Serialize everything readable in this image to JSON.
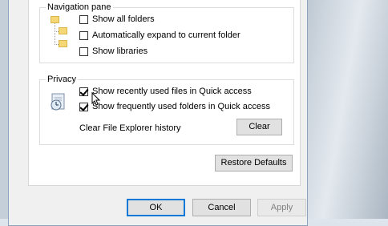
{
  "navigation_pane": {
    "title": "Navigation pane",
    "options": [
      {
        "label": "Show all folders",
        "checked": false
      },
      {
        "label": "Automatically expand to current folder",
        "checked": false
      },
      {
        "label": "Show libraries",
        "checked": false
      }
    ]
  },
  "privacy": {
    "title": "Privacy",
    "options": [
      {
        "label": "Show recently used files in Quick access",
        "checked": true
      },
      {
        "label": "Show frequently used folders in Quick access",
        "checked": true
      }
    ],
    "clear_label": "Clear File Explorer history",
    "clear_button": "Clear"
  },
  "restore_defaults_button": "Restore Defaults",
  "footer": {
    "ok": "OK",
    "cancel": "Cancel",
    "apply": "Apply"
  },
  "icons": {
    "nav_tree": "folder-tree-icon",
    "privacy": "privacy-icon"
  }
}
